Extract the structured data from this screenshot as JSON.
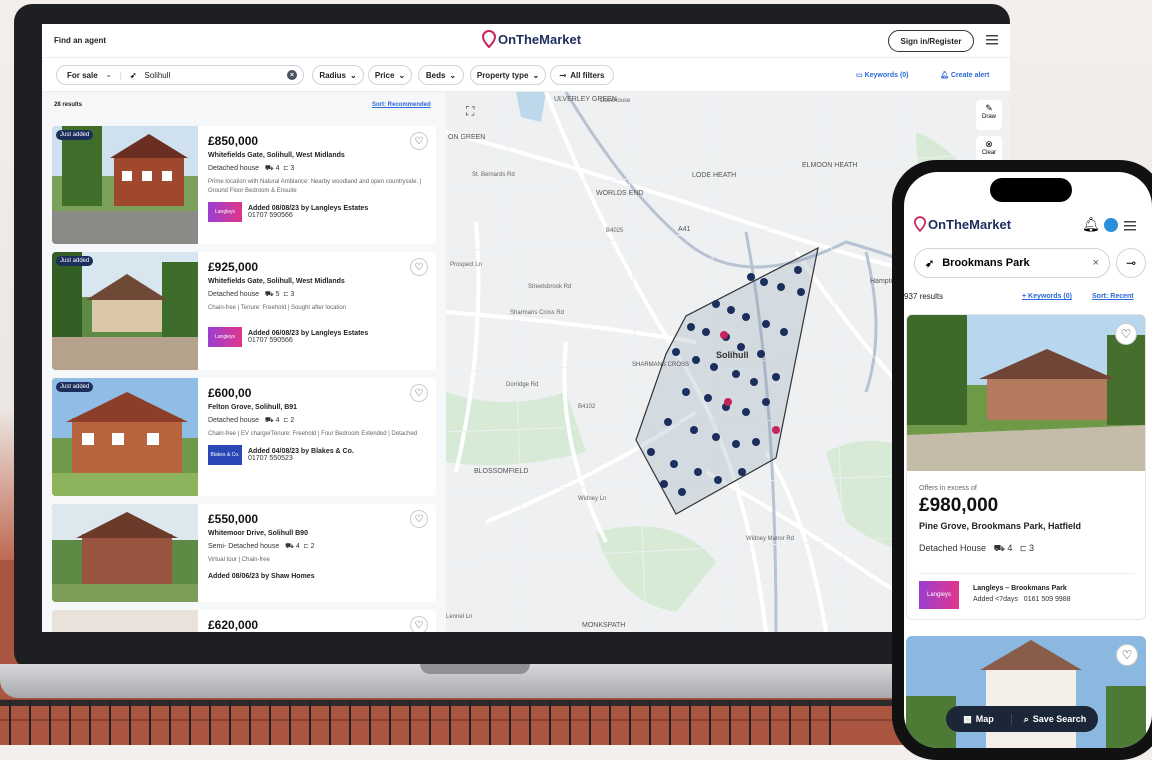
{
  "brand": {
    "name": "OnTheMarket",
    "color": "#c7245b",
    "navy": "#1c2e5c"
  },
  "laptop": {
    "find_agent": "Find an agent",
    "sign_in": "Sign in/Register",
    "menu_icon": "hamburger-icon",
    "filters": {
      "sale_type": "For sale",
      "location": "Solihull",
      "radius": "Radius",
      "price": "Price",
      "beds": "Beds",
      "property_type": "Property type",
      "all_filters": "All filters",
      "keywords": "Keywords (0)",
      "create_alert": "Create alert"
    },
    "results_count": "28 results",
    "sort": "Sort: Recommended",
    "map_tools": {
      "draw": "Draw",
      "clear": "Clear"
    },
    "map_labels": [
      "ULVERLEY GREEN",
      "Dovehouse",
      "ON GREEN",
      "LODE HEATH",
      "ELMOON HEATH",
      "WORLDS END",
      "A41",
      "Hampton",
      "Streetsbrook Rd",
      "Sharmans Cross Rd",
      "Solihull",
      "SHARMANS CROSS",
      "B4102",
      "BLOSSOMFIELD",
      "Widney Ln",
      "Widney Manor Rd",
      "MONKSPATH",
      "Lennel Ln",
      "Prospect Ln",
      "St. Bernards Rd",
      "B4025",
      "Dorridge Rd"
    ],
    "listings": [
      {
        "badge": "Just added",
        "price": "£850,000",
        "address": "Whitefields Gate, Solihull, West Midlands",
        "type": "Detached house",
        "beds": "4",
        "baths": "3",
        "desc": "Prime location with Natural Ambiance: Nearby woodland and open countryside. | Ground Floor Bedroom & Ensuite",
        "added": "Added 08/08/23 by Langleys Estates",
        "phone": "01707 590566",
        "agent_logo": "Langleys"
      },
      {
        "badge": "Just added",
        "price": "£925,000",
        "address": "Whitefields Gate, Solihull, West Midlands",
        "type": "Detached house",
        "beds": "5",
        "baths": "3",
        "desc": "Chain-free | Tenure: Freehold | Sought after location",
        "added": "Added 06/08/23 by Langleys Estates",
        "phone": "01707 590566",
        "agent_logo": "Langleys"
      },
      {
        "badge": "Just added",
        "price": "£600,00",
        "address": "Felton Grove, Solihull, B91",
        "type": "Detached house",
        "beds": "4",
        "baths": "2",
        "desc": "Chain-free | EV chargerTenure: Freehold | Four Bedroom Extended | Detached",
        "added": "Added 04/08/23 by Blakes & Co.",
        "phone": "01707 550523",
        "agent_logo": "Blakes & Co."
      },
      {
        "badge": "",
        "price": "£550,000",
        "address": "Whitemoor Drive, Solihull B90",
        "type": "Semi- Detached house",
        "beds": "4",
        "baths": "2",
        "desc": "Virtual tour | Chain-free",
        "added": "Added 08/06/23 by Shaw Homes",
        "phone": "",
        "agent_logo": ""
      },
      {
        "badge": "",
        "price": "£620,000",
        "address": "",
        "type": "",
        "beds": "",
        "baths": "",
        "desc": "",
        "added": "",
        "phone": "",
        "agent_logo": ""
      }
    ]
  },
  "phone": {
    "location": "Brookmans Park",
    "results_count": "937 results",
    "keywords": "+ Keywords (0)",
    "sort": "Sort: Recent",
    "listing": {
      "price_qualifier": "Offers in excess of",
      "price": "£980,000",
      "address": "Pine Grove, Brookmans Park, Hatfield",
      "type": "Detached House",
      "beds": "4",
      "baths": "3",
      "agent_name": "Langleys – Brookmans Park",
      "added": "Added <7days",
      "phone": "0161 509 9988",
      "agent_logo": "Langleys"
    },
    "map_button": "Map",
    "save_search": "Save Search"
  }
}
